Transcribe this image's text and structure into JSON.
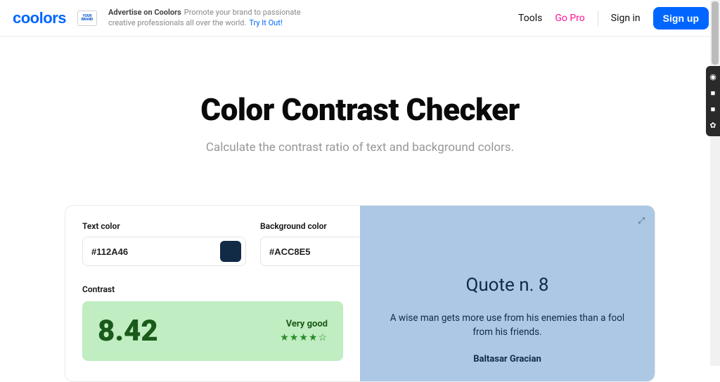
{
  "header": {
    "logo_text": "coolors",
    "brand_box": "YOUR BRAND",
    "ad_strong": "Advertise on Coolors",
    "ad_rest": "Promote your brand to passionate",
    "ad_line2": "creative professionals all over the world.",
    "ad_try": "Try It Out!",
    "nav": {
      "tools": "Tools",
      "go_pro": "Go Pro",
      "sign_in": "Sign in",
      "sign_up": "Sign up"
    }
  },
  "hero": {
    "title": "Color Contrast Checker",
    "subtitle": "Calculate the contrast ratio of text and background colors."
  },
  "inputs": {
    "text_label": "Text color",
    "text_value": "#112A46",
    "text_swatch": "#112A46",
    "bg_label": "Background color",
    "bg_value": "#ACC8E5",
    "bg_swatch": "#ACC8E5"
  },
  "contrast": {
    "label": "Contrast",
    "score": "8.42",
    "rating": "Very good",
    "stars": "★★★★☆"
  },
  "preview": {
    "title": "Quote n. 8",
    "body": "A wise man gets more use from his enemies than a fool from his friends.",
    "author": "Baltasar Gracian",
    "expand_icon": "⤢"
  },
  "side_tools": [
    "◉",
    "■",
    "■",
    "✿"
  ]
}
